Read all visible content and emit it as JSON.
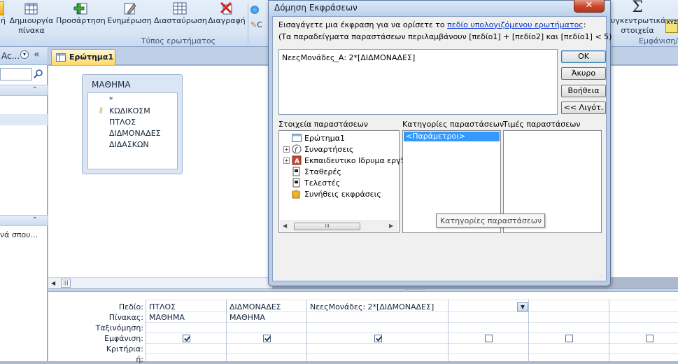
{
  "ribbon": {
    "partial_left_label": "ή",
    "buttons": [
      {
        "label1": "Δημιουργία",
        "label2": "πίνακα",
        "icon": "make-table-icon"
      },
      {
        "label1": "Προσάρτηση",
        "label2": "",
        "icon": "append-icon"
      },
      {
        "label1": "Ενημέρωση",
        "label2": "",
        "icon": "update-icon"
      },
      {
        "label1": "Διασταύρωση",
        "label2": "",
        "icon": "crosstab-icon"
      },
      {
        "label1": "Διαγραφή",
        "label2": "",
        "icon": "delete-icon"
      }
    ],
    "small_item_fragment": "C",
    "group_label": "Τύπος ερωτήματος",
    "right_button": {
      "label1": "υγκεντρωτικά",
      "label2": "στοιχεία",
      "icon": "totals-icon"
    },
    "right_group_label": "Εμφάνιση/",
    "xyz_icon_text": "XYZ"
  },
  "nav": {
    "header_text": "Ac...",
    "collapse_glyph": "«",
    "item_text": "νά σπου..."
  },
  "document": {
    "tab_label": "Ερώτημα1"
  },
  "table": {
    "title": "ΜΑΘΗΜΑ",
    "fields": [
      "*",
      "ΚΩΔΙΚΟΣΜ",
      "ΠΤΛΟΣ",
      "ΔΙΔΜΟΝΑΔΕΣ",
      "ΔΙΔΑΣΚΩΝ"
    ]
  },
  "grid": {
    "row_labels": [
      "Πεδίο:",
      "Πίνακας:",
      "Ταξινόμηση:",
      "Εμφάνιση:",
      "Κριτήρια:",
      "ή:"
    ],
    "columns": [
      {
        "field": "ΠΤΛΟΣ",
        "table": "ΜΑΘΗΜΑ",
        "show": true
      },
      {
        "field": "ΔΙΔΜΟΝΑΔΕΣ",
        "table": "ΜΑΘΗΜΑ",
        "show": true
      },
      {
        "field": "ΝεεςΜονάδες: 2*[ΔΙΔΜΟΝΑΔΕΣ]",
        "table": "",
        "show": true
      },
      {
        "field": "",
        "table": "",
        "show": false
      },
      {
        "field": "",
        "table": "",
        "show": false
      },
      {
        "field": "",
        "table": "",
        "show": false
      }
    ]
  },
  "dialog": {
    "title": "Δόμηση Εκφράσεων",
    "close_glyph": "✕",
    "desc_line1_pre": "Εισαγάγετε μια έκφραση για να ορίσετε το ",
    "desc_line1_link": "πεδίο υπολογιζόμενου ερωτήματος",
    "desc_line1_post": ":",
    "desc_line2": "(Τα παραδείγματα παραστάσεων περιλαμβάνουν [πεδίο1] + [πεδίο2] και [πεδίο1] < 5)",
    "expression": "ΝεεςΜονάδες_Α: 2*[ΔΙΔΜΟΝΑΔΕΣ]",
    "buttons": {
      "ok": "ΟΚ",
      "cancel": "Άκυρο",
      "help": "Βοήθεια",
      "less": "<< Λιγότ."
    },
    "pane1_label": "Στοιχεία παραστάσεων",
    "pane2_label": "Κατηγορίες παραστάσεων",
    "pane3_label": "Τιμές παραστάσεων",
    "tree": [
      {
        "label": "Ερώτημα1",
        "expander": "",
        "icon": "query-icon"
      },
      {
        "label": "Συναρτήσεις",
        "expander": "+",
        "icon": "function-icon"
      },
      {
        "label": "Εκπαιδευτικο Ιδρυμα εργ5",
        "expander": "+",
        "icon": "database-icon"
      },
      {
        "label": "Σταθερές",
        "expander": "",
        "icon": "constants-icon"
      },
      {
        "label": "Τελεστές",
        "expander": "",
        "icon": "operators-icon"
      },
      {
        "label": "Συνήθεις εκφράσεις",
        "expander": "",
        "icon": "common-expressions-icon"
      }
    ],
    "categories": [
      "<Παράμετροι>"
    ],
    "tooltip": "Κατηγορίες παραστάσεων",
    "scroll_thumb_glyph": "III"
  },
  "colors": {
    "ribbon_bg": "#d8e5f4",
    "app_bg": "#abb9cd",
    "selection": "#3399ff",
    "tab_active": "#ffd869",
    "close_button": "#c9462a"
  }
}
